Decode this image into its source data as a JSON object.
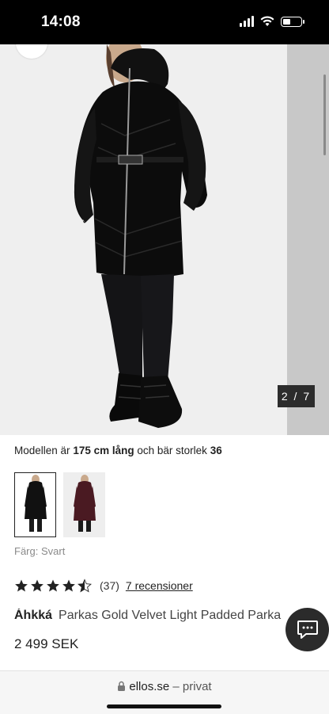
{
  "status_bar": {
    "time": "14:08"
  },
  "gallery": {
    "counter": "2 / 7",
    "current": 2,
    "total": 7
  },
  "model_info": {
    "prefix": "Modellen är",
    "height": "175 cm lång",
    "middle": "och bär storlek",
    "size": "36"
  },
  "swatches": [
    {
      "color_name": "Svart",
      "hex": "#111111",
      "selected": true
    },
    {
      "color_name": "Bordeaux",
      "hex": "#4a1a22",
      "selected": false
    }
  ],
  "color": {
    "label": "Färg:",
    "value": "Svart"
  },
  "rating": {
    "stars": 4.5,
    "max": 5,
    "count_text": "(37)",
    "link_text": "7 recensioner"
  },
  "product": {
    "brand": "Áhkká",
    "name": "Parkas Gold Velvet Light Padded Parka",
    "price": "2 499 SEK"
  },
  "browser": {
    "domain": "ellos.se",
    "suffix": "– privat"
  },
  "colors": {
    "accent_dark": "#2b2b2b",
    "muted_text": "#8a8a8a"
  },
  "icons": [
    "signal-icon",
    "wifi-icon",
    "battery-icon",
    "star-icon",
    "chat-icon",
    "lock-icon"
  ]
}
